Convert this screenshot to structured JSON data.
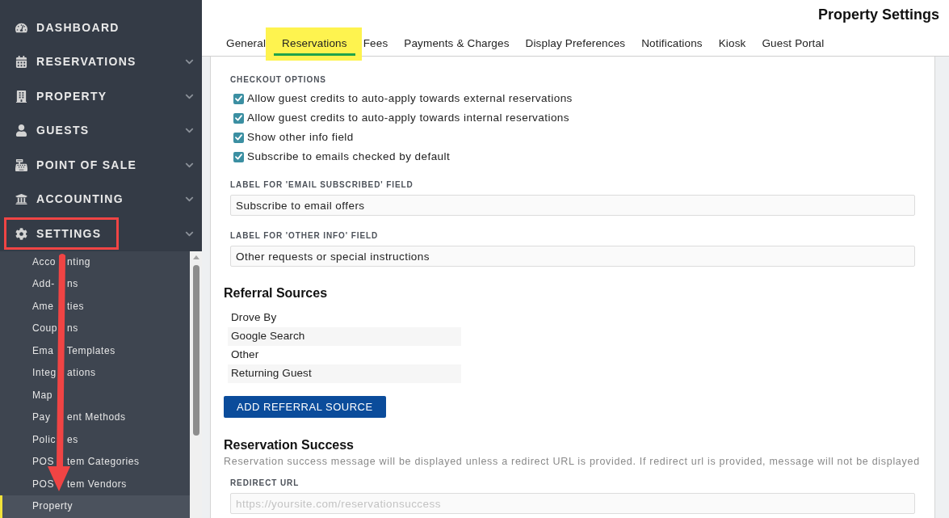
{
  "sidebar": {
    "items": [
      {
        "label": "DASHBOARD",
        "expandable": false,
        "highlighted": false
      },
      {
        "label": "RESERVATIONS",
        "expandable": true,
        "highlighted": false
      },
      {
        "label": "PROPERTY",
        "expandable": true,
        "highlighted": false
      },
      {
        "label": "GUESTS",
        "expandable": true,
        "highlighted": false
      },
      {
        "label": "POINT OF SALE",
        "expandable": true,
        "highlighted": false
      },
      {
        "label": "ACCOUNTING",
        "expandable": true,
        "highlighted": false
      },
      {
        "label": "SETTINGS",
        "expandable": true,
        "highlighted": true,
        "children": [
          {
            "text_parts": [
              "Acco",
              "nting"
            ],
            "selected": false
          },
          {
            "text_parts": [
              "Add-",
              "ns"
            ],
            "selected": false
          },
          {
            "text_parts": [
              "Ame",
              "ties"
            ],
            "selected": false
          },
          {
            "text_parts": [
              "Coup",
              "ns"
            ],
            "selected": false
          },
          {
            "text_parts": [
              "Ema",
              "Templates"
            ],
            "selected": false
          },
          {
            "text_parts": [
              "Integ",
              "ations"
            ],
            "selected": false
          },
          {
            "text_parts": [
              "Map"
            ],
            "selected": false
          },
          {
            "text_parts": [
              "Pay",
              "ent Methods"
            ],
            "selected": false
          },
          {
            "text_parts": [
              "Polic",
              "es"
            ],
            "selected": false
          },
          {
            "text_parts": [
              "POS",
              "tem Categories"
            ],
            "selected": false
          },
          {
            "text_parts": [
              "POS",
              "tem Vendors"
            ],
            "selected": false
          },
          {
            "text_parts": [
              "Property"
            ],
            "selected": true
          }
        ]
      }
    ]
  },
  "page_title": "Property Settings",
  "tabs": [
    {
      "label": "General",
      "selected": false,
      "highlighted": false
    },
    {
      "label": "Reservations",
      "selected": true,
      "highlighted": true
    },
    {
      "label": "Fees",
      "selected": false,
      "highlighted": false
    },
    {
      "label": "Payments & Charges",
      "selected": false,
      "highlighted": false
    },
    {
      "label": "Display Preferences",
      "selected": false,
      "highlighted": false
    },
    {
      "label": "Notifications",
      "selected": false,
      "highlighted": false
    },
    {
      "label": "Kiosk",
      "selected": false,
      "highlighted": false
    },
    {
      "label": "Guest Portal",
      "selected": false,
      "highlighted": false
    }
  ],
  "checkout_options": {
    "heading": "CHECKOUT OPTIONS",
    "options": [
      {
        "label": "Allow guest credits to auto-apply towards external reservations",
        "checked": true
      },
      {
        "label": "Allow guest credits to auto-apply towards internal reservations",
        "checked": true
      },
      {
        "label": "Show other info field",
        "checked": true
      },
      {
        "label": "Subscribe to emails checked by default",
        "checked": true
      }
    ]
  },
  "fields": [
    {
      "label": "LABEL FOR 'EMAIL SUBSCRIBED' FIELD",
      "value": "Subscribe to email offers"
    },
    {
      "label": "LABEL FOR 'OTHER INFO' FIELD",
      "value": "Other requests or special instructions"
    }
  ],
  "referral_sources": {
    "heading": "Referral Sources",
    "items": [
      "Drove By",
      "Google Search",
      "Other",
      "Returning Guest"
    ],
    "button": "ADD REFERRAL SOURCE"
  },
  "reservation_success": {
    "heading": "Reservation Success",
    "description": "Reservation success message will be displayed unless a redirect URL is provided. If redirect url is provided, message will not be displayed",
    "field": {
      "label": "REDIRECT URL",
      "placeholder": "https://yoursite.com/reservationsuccess"
    }
  }
}
